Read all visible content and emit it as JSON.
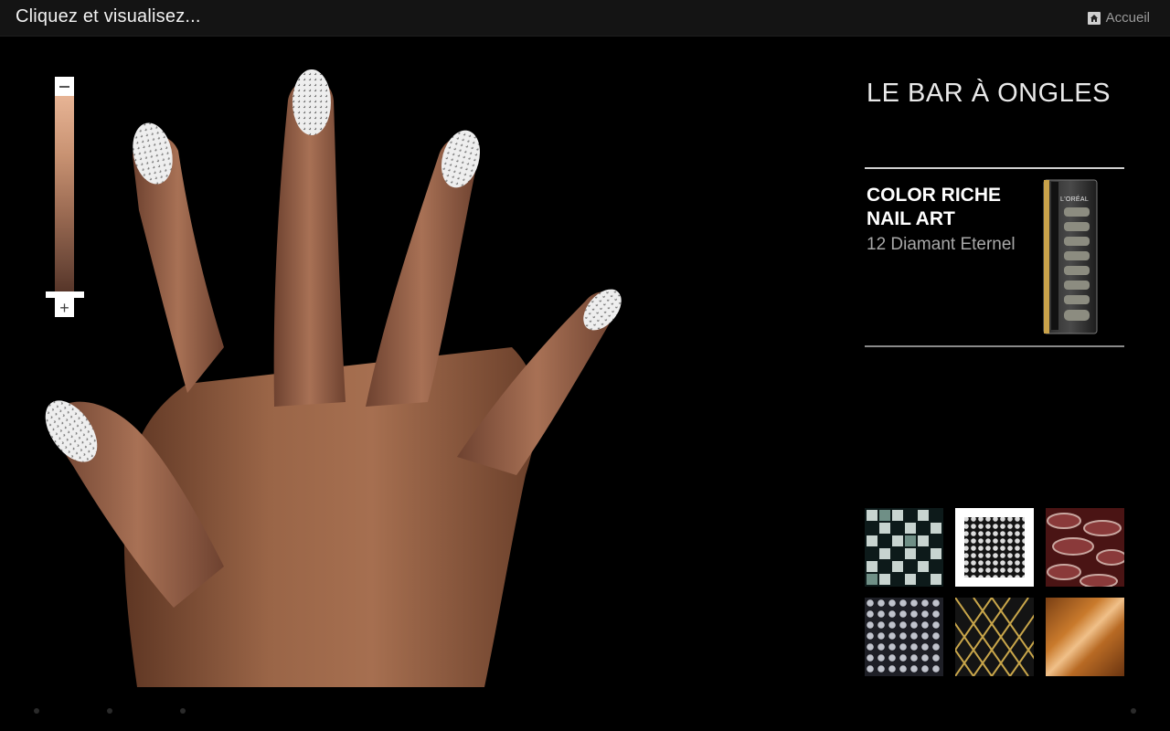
{
  "header": {
    "title": "Cliquez et visualisez...",
    "home_label": "Accueil",
    "home_icon": "home-icon"
  },
  "tone_slider": {
    "minus_icon": "minus-icon",
    "plus_icon": "plus-icon",
    "level": 1.0
  },
  "panel": {
    "brand_title": "LE BAR À ONGLES",
    "product": {
      "name_line1": "COLOR RICHE",
      "name_line2": "NAIL ART",
      "shade": "12 Diamant Eternel",
      "pack_brand": "L'ORÉAL"
    },
    "swatches": [
      {
        "name": "mosaic-silver",
        "selected": false
      },
      {
        "name": "diamant-eternel",
        "selected": true
      },
      {
        "name": "python-brown",
        "selected": false
      },
      {
        "name": "dots-silver",
        "selected": false
      },
      {
        "name": "gold-lattice",
        "selected": false
      },
      {
        "name": "gold-foil",
        "selected": false
      }
    ]
  },
  "colors": {
    "skin": "#8d5a3f",
    "nail": "#e9e9e9",
    "accent": "#ffffff"
  }
}
